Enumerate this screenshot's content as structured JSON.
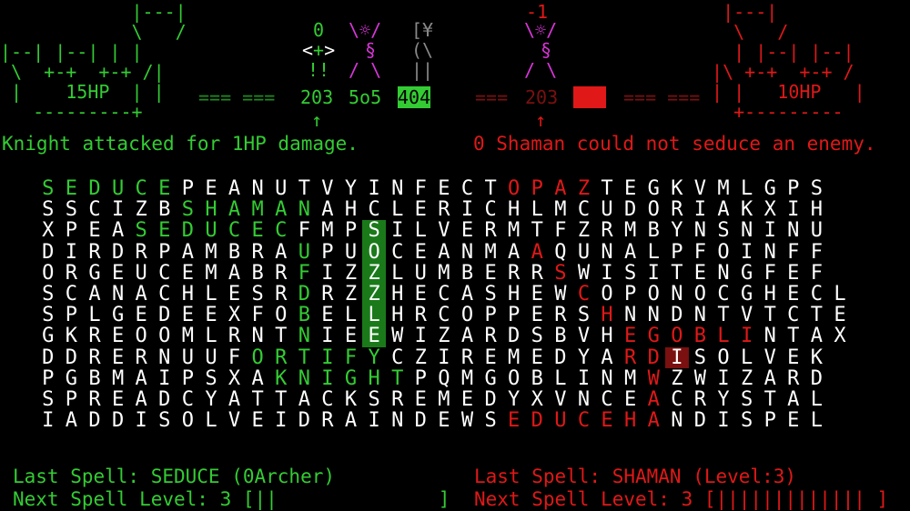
{
  "player1": {
    "castle_art": "            |---|\n            \\   /\n|--| |--| | |\n \\  +-+  +-+ /|\n |    15HP    | |\n   ---------+",
    "hp_label": "15HP",
    "units_row": "=== === 2",
    "colors": {
      "main": "#33cc33",
      "highlight_bg": "#1a7a1a"
    }
  },
  "player2": {
    "castle_art": "|---|\n \\   /\n | |--| |--|\n|\\ +-+  +-+ /\n| |   10HP   |\n  +---------",
    "hp_label": "10HP",
    "colors": {
      "main": "#e01818",
      "highlight_bg": "#7a1010"
    }
  },
  "units": {
    "archer": {
      "art": "0\n<+>\n!!",
      "color": "#33cc33"
    },
    "shaman_green": {
      "art": "\\☼/\n§\n/ \\",
      "color": "#d936d9"
    },
    "knight": {
      "art": "[¥\n(\\\n||",
      "color": "#777777"
    },
    "shaman_red": {
      "art": "-1\n\\☼/\n§\n/ \\",
      "color": "#d936d9"
    },
    "lane": [
      {
        "text": "=== ===",
        "color": "#33cc33",
        "bg": ""
      },
      {
        "text": "203",
        "color": "#33cc33",
        "bg": ""
      },
      {
        "text": "5o5",
        "color": "#33cc33",
        "bg": ""
      },
      {
        "text": "404",
        "color": "#000000",
        "bg": "#33cc33"
      },
      {
        "text": "===",
        "color": "#7a1010",
        "bg": ""
      },
      {
        "text": "203",
        "color": "#7a1010",
        "bg": ""
      },
      {
        "text": "===",
        "color": "#e01818",
        "bg": "#e01818"
      },
      {
        "text": "=== ===",
        "color": "#7a1010",
        "bg": ""
      }
    ]
  },
  "messages": {
    "left": "Knight attacked for 1HP damage.",
    "right": "0 Shaman could not seduce an enemy."
  },
  "grid": {
    "rows": [
      "SEDUCEPEANUTVYINFECTOPAZTEGKVMLGPS",
      "SSCIZBSHAMANAHCLERICHLMCUDORIAKXIH",
      "XPEASEDUCECFMPSILVERMTFZRMBYNSNINU",
      "DIRDRPAMBRAUPUOCEANMAAQUNALPFOINFF",
      "ORGEUCEMABRFIZZLUMBERRSWISITENGFEF",
      "SCANACHLESRDRZZHECASHEWCOPONOCGHECL",
      "SPLGEDEEXFOBELLHRCOPPERSHNNDNTVTCTE",
      "GKREOOMLRNTNIEEWIZARDSBVHEGOBLINTAX",
      "DDRERNUUFORTIFYCZIREMEDYARDISOLVEK",
      "PGBMAIPSXAKNIGHTPQMGOBLINMWZWIZARD",
      "SPREADCYATTACKSREMEDYXVNCEACRYSTAL",
      "IADDISOLVEIDRAINDEWSEDUCEHANDISPEL"
    ],
    "styles": [
      "g..............................................................",
      ""
    ],
    "green_cells": [
      [
        0,
        0
      ],
      [
        0,
        1
      ],
      [
        0,
        2
      ],
      [
        0,
        3
      ],
      [
        0,
        4
      ],
      [
        0,
        5
      ],
      [
        1,
        6
      ],
      [
        1,
        7
      ],
      [
        1,
        8
      ],
      [
        1,
        9
      ],
      [
        1,
        10
      ],
      [
        1,
        11
      ],
      [
        2,
        4
      ],
      [
        2,
        5
      ],
      [
        2,
        6
      ],
      [
        2,
        7
      ],
      [
        2,
        8
      ],
      [
        2,
        9
      ],
      [
        2,
        10
      ],
      [
        3,
        11
      ],
      [
        4,
        11
      ],
      [
        5,
        11
      ],
      [
        6,
        11
      ],
      [
        7,
        11
      ],
      [
        8,
        9
      ],
      [
        8,
        10
      ],
      [
        8,
        11
      ],
      [
        8,
        12
      ],
      [
        8,
        13
      ],
      [
        8,
        14
      ],
      [
        9,
        10
      ],
      [
        9,
        11
      ],
      [
        9,
        12
      ],
      [
        9,
        13
      ],
      [
        9,
        14
      ],
      [
        9,
        15
      ]
    ],
    "green_bg_cells": [
      [
        2,
        14
      ],
      [
        3,
        14
      ],
      [
        4,
        14
      ],
      [
        5,
        14
      ],
      [
        6,
        14
      ],
      [
        7,
        14
      ]
    ],
    "red_cells": [
      [
        0,
        20
      ],
      [
        0,
        21
      ],
      [
        0,
        22
      ],
      [
        0,
        23
      ],
      [
        3,
        21
      ],
      [
        4,
        22
      ],
      [
        5,
        23
      ],
      [
        6,
        24
      ],
      [
        7,
        25
      ],
      [
        7,
        26
      ],
      [
        7,
        27
      ],
      [
        7,
        28
      ],
      [
        7,
        29
      ],
      [
        7,
        30
      ],
      [
        8,
        25
      ],
      [
        8,
        26
      ],
      [
        9,
        26
      ],
      [
        10,
        26
      ],
      [
        11,
        26
      ],
      [
        11,
        20
      ],
      [
        11,
        21
      ],
      [
        11,
        22
      ],
      [
        11,
        23
      ],
      [
        11,
        24
      ],
      [
        11,
        25
      ]
    ],
    "red_bg_cells": [
      [
        8,
        27
      ]
    ]
  },
  "footer": {
    "p1_last_spell": "Last Spell: SEDUCE (0Archer)",
    "p1_next_level": "Next Spell Level: 3 [||              ]",
    "p2_last_spell": "Last Spell: SHAMAN (Level:3)",
    "p2_next_level": "Next Spell Level: 3 [||||||||||||| ]"
  }
}
